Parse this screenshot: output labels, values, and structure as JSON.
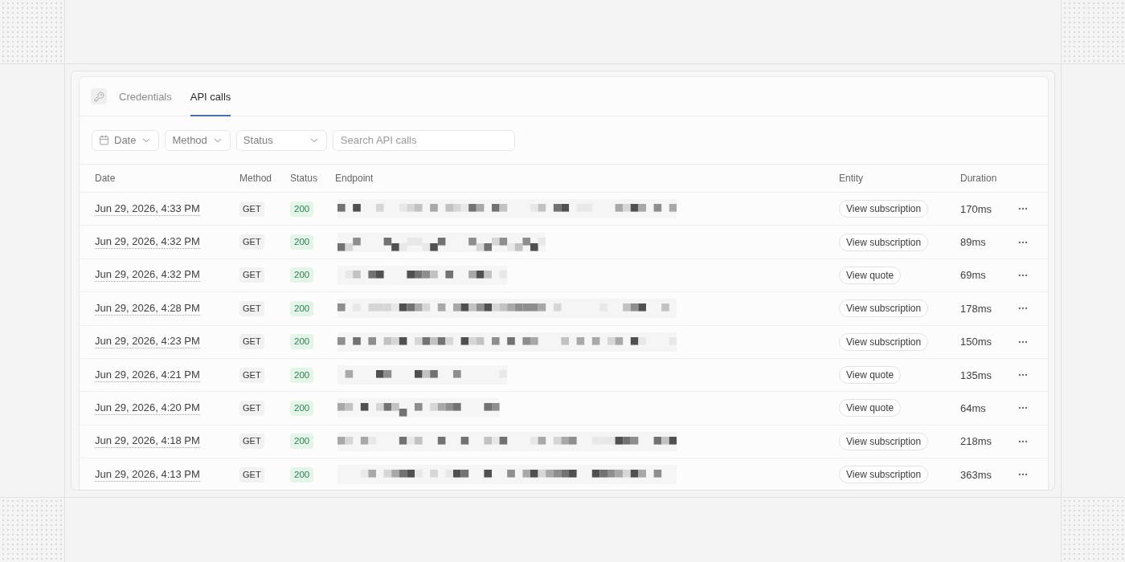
{
  "tabs": [
    {
      "label": "Credentials",
      "selected": false
    },
    {
      "label": "API calls",
      "selected": true
    }
  ],
  "filters": [
    {
      "kind": "date",
      "label": "Date"
    },
    {
      "kind": "select",
      "label": "Method"
    },
    {
      "kind": "select",
      "label": "Status"
    }
  ],
  "search": {
    "placeholder": "Search API calls"
  },
  "table": {
    "columns": [
      "Date",
      "Method",
      "Status",
      "Endpoint",
      "Entity",
      "Duration"
    ],
    "rows": [
      {
        "date": "Jun 29, 2026, 4:33 PM",
        "method": "GET",
        "status": "200",
        "entity": "View subscription",
        "duration": "170ms"
      },
      {
        "date": "Jun 29, 2026, 4:32 PM",
        "method": "GET",
        "status": "200",
        "entity": "View subscription",
        "duration": "89ms"
      },
      {
        "date": "Jun 29, 2026, 4:32 PM",
        "method": "GET",
        "status": "200",
        "entity": "View quote",
        "duration": "69ms"
      },
      {
        "date": "Jun 29, 2026, 4:28 PM",
        "method": "GET",
        "status": "200",
        "entity": "View subscription",
        "duration": "178ms"
      },
      {
        "date": "Jun 29, 2026, 4:23 PM",
        "method": "GET",
        "status": "200",
        "entity": "View subscription",
        "duration": "150ms"
      },
      {
        "date": "Jun 29, 2026, 4:21 PM",
        "method": "GET",
        "status": "200",
        "entity": "View quote",
        "duration": "135ms"
      },
      {
        "date": "Jun 29, 2026, 4:20 PM",
        "method": "GET",
        "status": "200",
        "entity": "View quote",
        "duration": "64ms"
      },
      {
        "date": "Jun 29, 2026, 4:18 PM",
        "method": "GET",
        "status": "200",
        "entity": "View subscription",
        "duration": "218ms"
      },
      {
        "date": "Jun 29, 2026, 4:13 PM",
        "method": "GET",
        "status": "200",
        "entity": "View subscription",
        "duration": "363ms"
      }
    ]
  }
}
